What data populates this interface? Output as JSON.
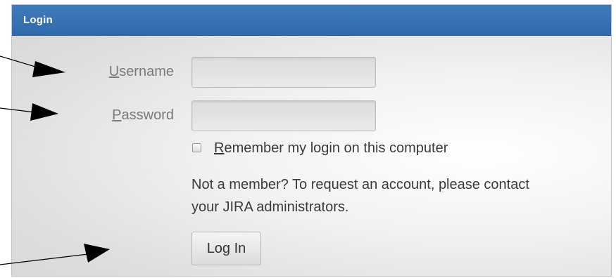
{
  "panel": {
    "title": "Login"
  },
  "form": {
    "username": {
      "mnemonic": "U",
      "label_rest": "sername",
      "value": ""
    },
    "password": {
      "mnemonic": "P",
      "label_rest": "assword",
      "value": ""
    },
    "remember": {
      "mnemonic": "R",
      "label_rest": "emember my login on this computer",
      "checked": false
    },
    "info_line1": "Not a member? To request an account, please contact",
    "info_line2": "your JIRA administrators.",
    "submit_label": "Log In"
  },
  "colors": {
    "header": "#3572b3",
    "arrow": "#000000"
  }
}
